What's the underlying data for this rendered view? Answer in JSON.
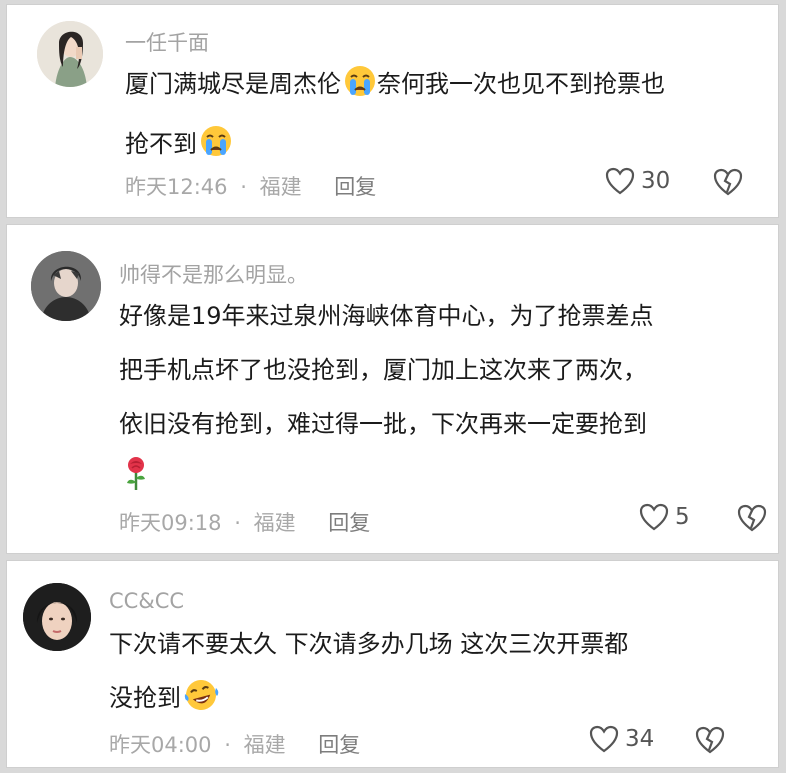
{
  "comments": [
    {
      "username": "一任千面",
      "lines": [
        "厦门满城尽是周杰伦",
        "奈何我一次也见不到抢票也",
        "抢不到"
      ],
      "time": "昨天12:46",
      "location": "福建",
      "separator": "·",
      "reply_label": "回复",
      "likes": "30",
      "emoji": [
        "crying-emoji",
        "crying-emoji"
      ]
    },
    {
      "username": "帅得不是那么明显。",
      "lines": [
        "好像是19年来过泉州海峡体育中心，为了抢票差点",
        "把手机点坏了也没抢到，厦门加上这次来了两次，",
        "依旧没有抢到，难过得一批，下次再来一定要抢到"
      ],
      "time": "昨天09:18",
      "location": "福建",
      "separator": "·",
      "reply_label": "回复",
      "likes": "5",
      "emoji": [
        "rose-emoji"
      ]
    },
    {
      "username": "CC&CC",
      "lines": [
        "下次请不要太久 下次请多办几场 这次三次开票都",
        "没抢到"
      ],
      "time": "昨天04:00",
      "location": "福建",
      "separator": "·",
      "reply_label": "回复",
      "likes": "34",
      "emoji": [
        "laugh-cry-emoji"
      ]
    }
  ],
  "colors": {
    "background": "#d9d9d9",
    "card": "#ffffff",
    "username": "#a3a3a3",
    "text": "#1b1b1b",
    "meta": "#a8a8a8"
  }
}
